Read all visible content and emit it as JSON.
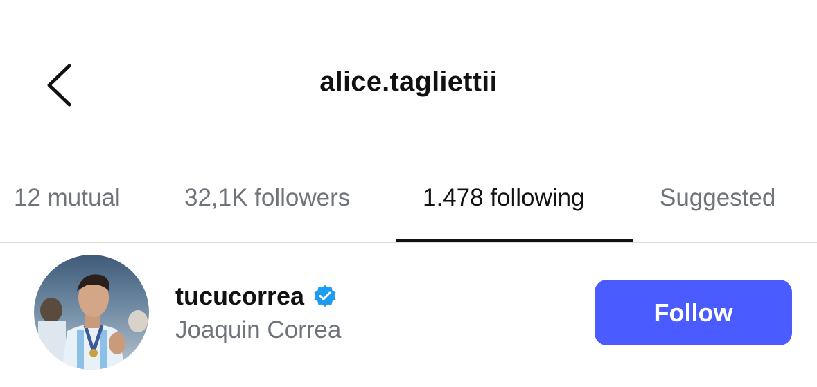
{
  "header": {
    "title": "alice.tagliettii",
    "back_icon": "chevron-left-icon"
  },
  "tabs": [
    {
      "label": "12 mutual",
      "active": false
    },
    {
      "label": "32,1K followers",
      "active": false
    },
    {
      "label": "1.478 following",
      "active": true
    },
    {
      "label": "Suggested",
      "active": false
    }
  ],
  "list": [
    {
      "username": "tucucorrea",
      "verified": true,
      "full_name": "Joaquin Correa",
      "action_label": "Follow"
    }
  ],
  "colors": {
    "follow_button": "#4a5cff",
    "verified_badge": "#1d9bf0",
    "secondary_text": "#6f737b",
    "primary_text": "#111111"
  }
}
